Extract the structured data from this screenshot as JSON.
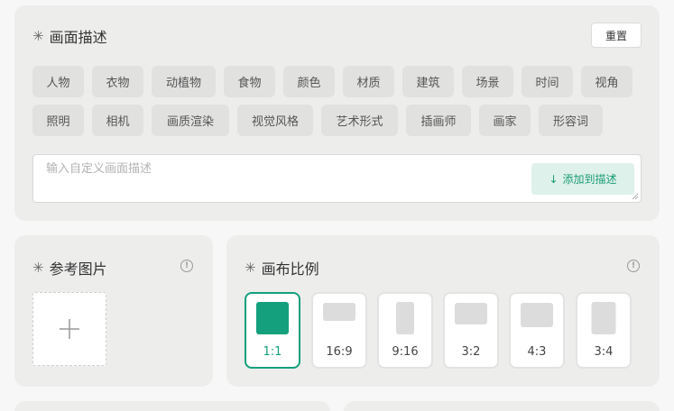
{
  "description": {
    "title": "画面描述",
    "title_icon": "sparkle-icon",
    "reset_label": "重置",
    "tags_row1": [
      "人物",
      "衣物",
      "动植物",
      "食物",
      "颜色",
      "材质",
      "建筑",
      "场景",
      "时间",
      "视角"
    ],
    "tags_row2": [
      "照明",
      "相机",
      "画质渲染",
      "视觉风格",
      "艺术形式",
      "插画师",
      "画家",
      "形容词"
    ],
    "input": {
      "value": "",
      "placeholder": "输入自定义画面描述"
    },
    "add_button_label": "添加到描述",
    "add_button_icon": "arrow-down-icon"
  },
  "reference": {
    "title": "参考图片",
    "title_icon": "sparkle-icon",
    "info_icon": "info-icon",
    "upload_icon": "plus-icon"
  },
  "canvas_ratio": {
    "title": "画布比例",
    "title_icon": "sparkle-icon",
    "info_icon": "info-icon",
    "selected": "1:1",
    "options": [
      "1:1",
      "16:9",
      "9:16",
      "3:2",
      "4:3",
      "3:4"
    ]
  },
  "colors": {
    "accent": "#14a07c",
    "accent_light": "#def1ea",
    "card_bg": "#ededec",
    "tag_bg": "#e1e2e0",
    "page_bg": "#f7f7f7"
  }
}
